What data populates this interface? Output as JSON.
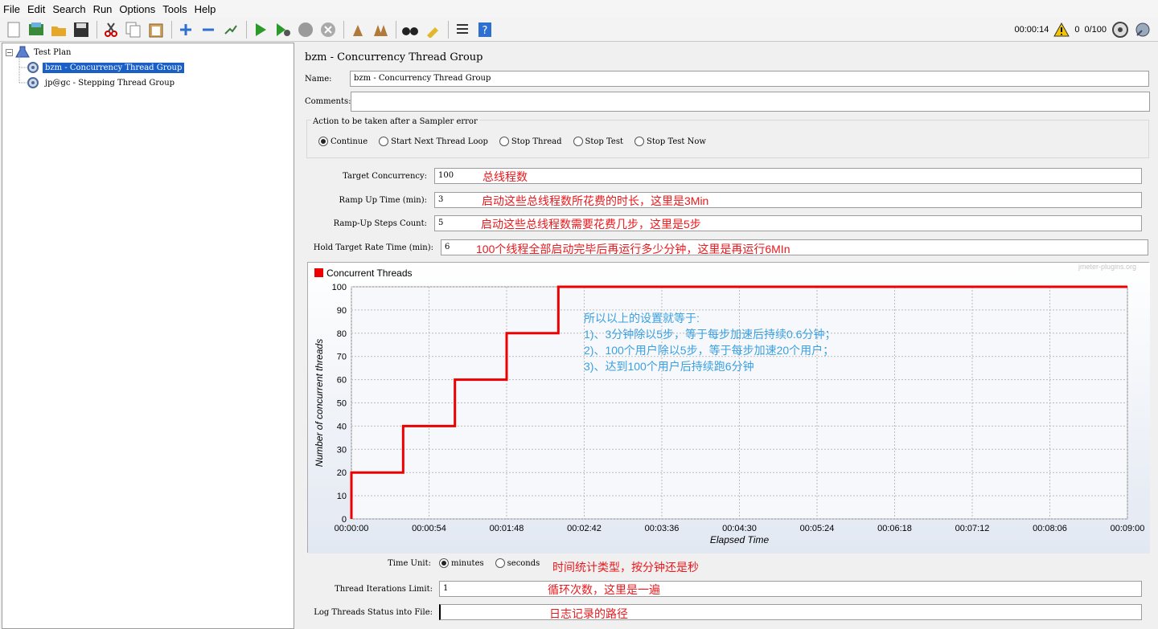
{
  "menu": [
    "File",
    "Edit",
    "Search",
    "Run",
    "Options",
    "Tools",
    "Help"
  ],
  "status": {
    "elapsed": "00:00:14",
    "warnings": "0",
    "threads": "0/100"
  },
  "tree": {
    "root": "Test Plan",
    "items": [
      "bzm - Concurrency Thread Group",
      "jp@gc - Stepping Thread Group"
    ]
  },
  "panel": {
    "title": "bzm - Concurrency Thread Group",
    "name_label": "Name:",
    "name_value": "bzm - Concurrency Thread Group",
    "comments_label": "Comments:",
    "comments_value": "",
    "error_group_label": "Action to be taken after a Sampler error",
    "error_options": [
      "Continue",
      "Start Next Thread Loop",
      "Stop Thread",
      "Stop Test",
      "Stop Test Now"
    ],
    "error_selected": "Continue",
    "target_label": "Target Concurrency:",
    "target_value": "100",
    "target_note": "总线程数",
    "rampup_label": "Ramp Up Time (min):",
    "rampup_value": "3",
    "rampup_note": "启动这些总线程数所花费的时长，这里是3Min",
    "steps_label": "Ramp-Up Steps Count:",
    "steps_value": "5",
    "steps_note": "启动这些总线程数需要花费几步，这里是5步",
    "hold_label": "Hold Target Rate Time (min):",
    "hold_value": "6",
    "hold_note": "100个线程全部启动完毕后再运行多少分钟，这里是再运行6MIn",
    "timeunit_label": "Time Unit:",
    "timeunit_options": [
      "minutes",
      "seconds"
    ],
    "timeunit_selected": "minutes",
    "timeunit_note": "时间统计类型，按分钟还是秒",
    "iter_label": "Thread Iterations Limit:",
    "iter_value": "1",
    "iter_note": "循环次数，这里是一遍",
    "log_label": "Log Threads Status into File:",
    "log_value": "",
    "log_note": "日志记录的路径"
  },
  "chart_notes": {
    "line1": "所以以上的设置就等于:",
    "line2": "1)、3分钟除以5步，等于每步加速后持续0.6分钟；",
    "line3": "2)、100个用户除以5步，等于每步加速20个用户；",
    "line4": "3)、达到100个用户后持续跑6分钟"
  },
  "chart_data": {
    "type": "line",
    "title": "",
    "watermark": "jmeter-plugins.org",
    "xlabel": "Elapsed Time",
    "ylabel": "Number of concurrent threads",
    "ylim": [
      0,
      100
    ],
    "xlim": [
      "00:00:00",
      "00:09:00"
    ],
    "xticks": [
      "00:00:00",
      "00:00:54",
      "00:01:48",
      "00:02:42",
      "00:03:36",
      "00:04:30",
      "00:05:24",
      "00:06:18",
      "00:07:12",
      "00:08:06",
      "00:09:00"
    ],
    "yticks": [
      0,
      10,
      20,
      30,
      40,
      50,
      60,
      70,
      80,
      90,
      100
    ],
    "series": [
      {
        "name": "Concurrent Threads",
        "color": "#ee0000",
        "points": [
          [
            "00:00:00",
            0
          ],
          [
            "00:00:00",
            20
          ],
          [
            "00:00:36",
            20
          ],
          [
            "00:00:36",
            40
          ],
          [
            "00:01:12",
            40
          ],
          [
            "00:01:12",
            60
          ],
          [
            "00:01:48",
            60
          ],
          [
            "00:01:48",
            80
          ],
          [
            "00:02:24",
            80
          ],
          [
            "00:02:24",
            100
          ],
          [
            "00:09:00",
            100
          ]
        ]
      }
    ],
    "grid": true,
    "legend": "top-left"
  }
}
